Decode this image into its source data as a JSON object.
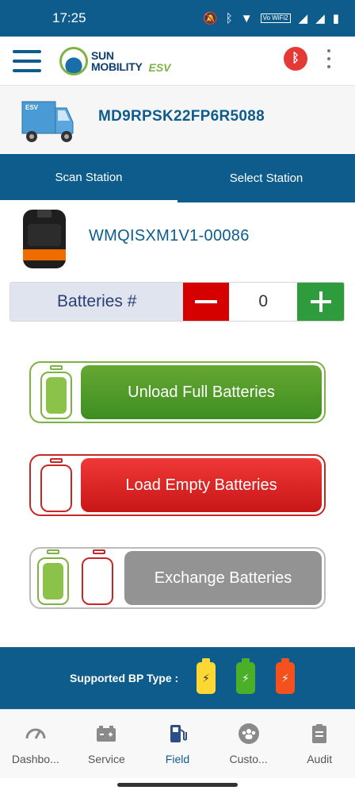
{
  "status_bar": {
    "time": "17:25",
    "vowifi": "Vo WiFi2"
  },
  "app_bar": {
    "logo_line1": "SUN",
    "logo_line2": "MOBILITY",
    "logo_suffix": "ESV"
  },
  "vehicle": {
    "badge": "ESV",
    "id": "MD9RPSK22FP6R5088"
  },
  "tabs": [
    {
      "label": "Scan Station"
    },
    {
      "label": "Select Station"
    }
  ],
  "station": {
    "id": "WMQISXM1V1-00086"
  },
  "battery_counter": {
    "label": "Batteries #",
    "value": "0"
  },
  "actions": {
    "unload": "Unload Full Batteries",
    "load": "Load Empty Batteries",
    "exchange": "Exchange Batteries"
  },
  "supported_bp": {
    "label": "Supported BP Type :"
  },
  "bottom_nav": [
    {
      "label": "Dashbo..."
    },
    {
      "label": "Service"
    },
    {
      "label": "Field"
    },
    {
      "label": "Custo..."
    },
    {
      "label": "Audit"
    }
  ],
  "colors": {
    "primary": "#0d5c8c",
    "green": "#3e8d22",
    "red": "#d50000",
    "grey": "#939393",
    "bp_yellow": "#fdd835",
    "bp_green": "#4caf28",
    "bp_red": "#f4511e"
  }
}
